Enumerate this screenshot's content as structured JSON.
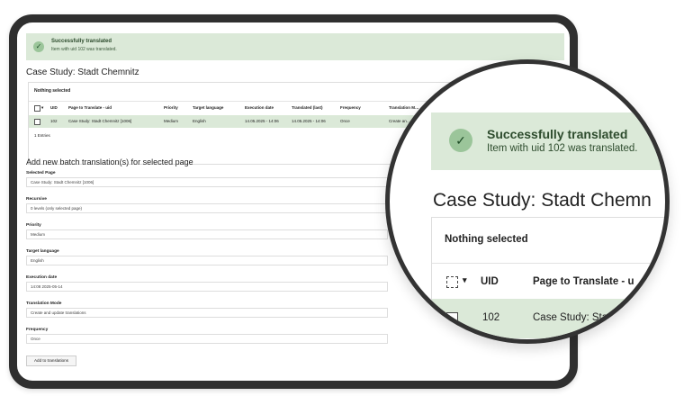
{
  "alert": {
    "title": "Successfully translated",
    "message": "Item with uid 102 was translated."
  },
  "page": {
    "title": "Case Study: Stadt Chemnitz",
    "title_zoom": "Case Study: Stadt Chemn"
  },
  "table": {
    "selection_status": "Nothing selected",
    "columns": [
      "UID",
      "Page to Translate - uid",
      "Priority",
      "Target language",
      "Execution date",
      "Translated (last)",
      "Frequency",
      "Translation M…"
    ],
    "columns_zoom": [
      "UID",
      "Page to Translate - u"
    ],
    "row": {
      "uid": "102",
      "page": "Case Study: Stadt Chemnitz [1006]",
      "page_zoom": "Case Study: Stadt",
      "priority": "Medium",
      "language": "English",
      "execution_date": "14.05.2025 - 14:06",
      "translated_last": "14.05.2025 - 14:06",
      "frequency": "Once",
      "mode": "Create an…"
    },
    "entries": "1 Entries"
  },
  "form": {
    "heading": "Add new batch translation(s) for selected page",
    "fields": [
      {
        "label": "Selected Page",
        "value": "Case Study: Stadt Chemnitz [1006]"
      },
      {
        "label": "Recursive",
        "value": "0 levels (only selected page)"
      },
      {
        "label": "Priority",
        "value": "Medium"
      },
      {
        "label": "Target language",
        "value": "English"
      },
      {
        "label": "Execution date",
        "value": "14:08 2025-05-14"
      },
      {
        "label": "Translation Mode",
        "value": "Create and update translations"
      },
      {
        "label": "Frequency",
        "value": "Once"
      }
    ],
    "submit_label": "Add to translations"
  },
  "icons": {
    "success": "checkmark-icon",
    "select_dropdown": "chevron-down-icon"
  },
  "colors": {
    "success_bg": "#dbe9d8",
    "success_icon_bg": "#9bc59a",
    "frame": "#2f2f2f"
  }
}
